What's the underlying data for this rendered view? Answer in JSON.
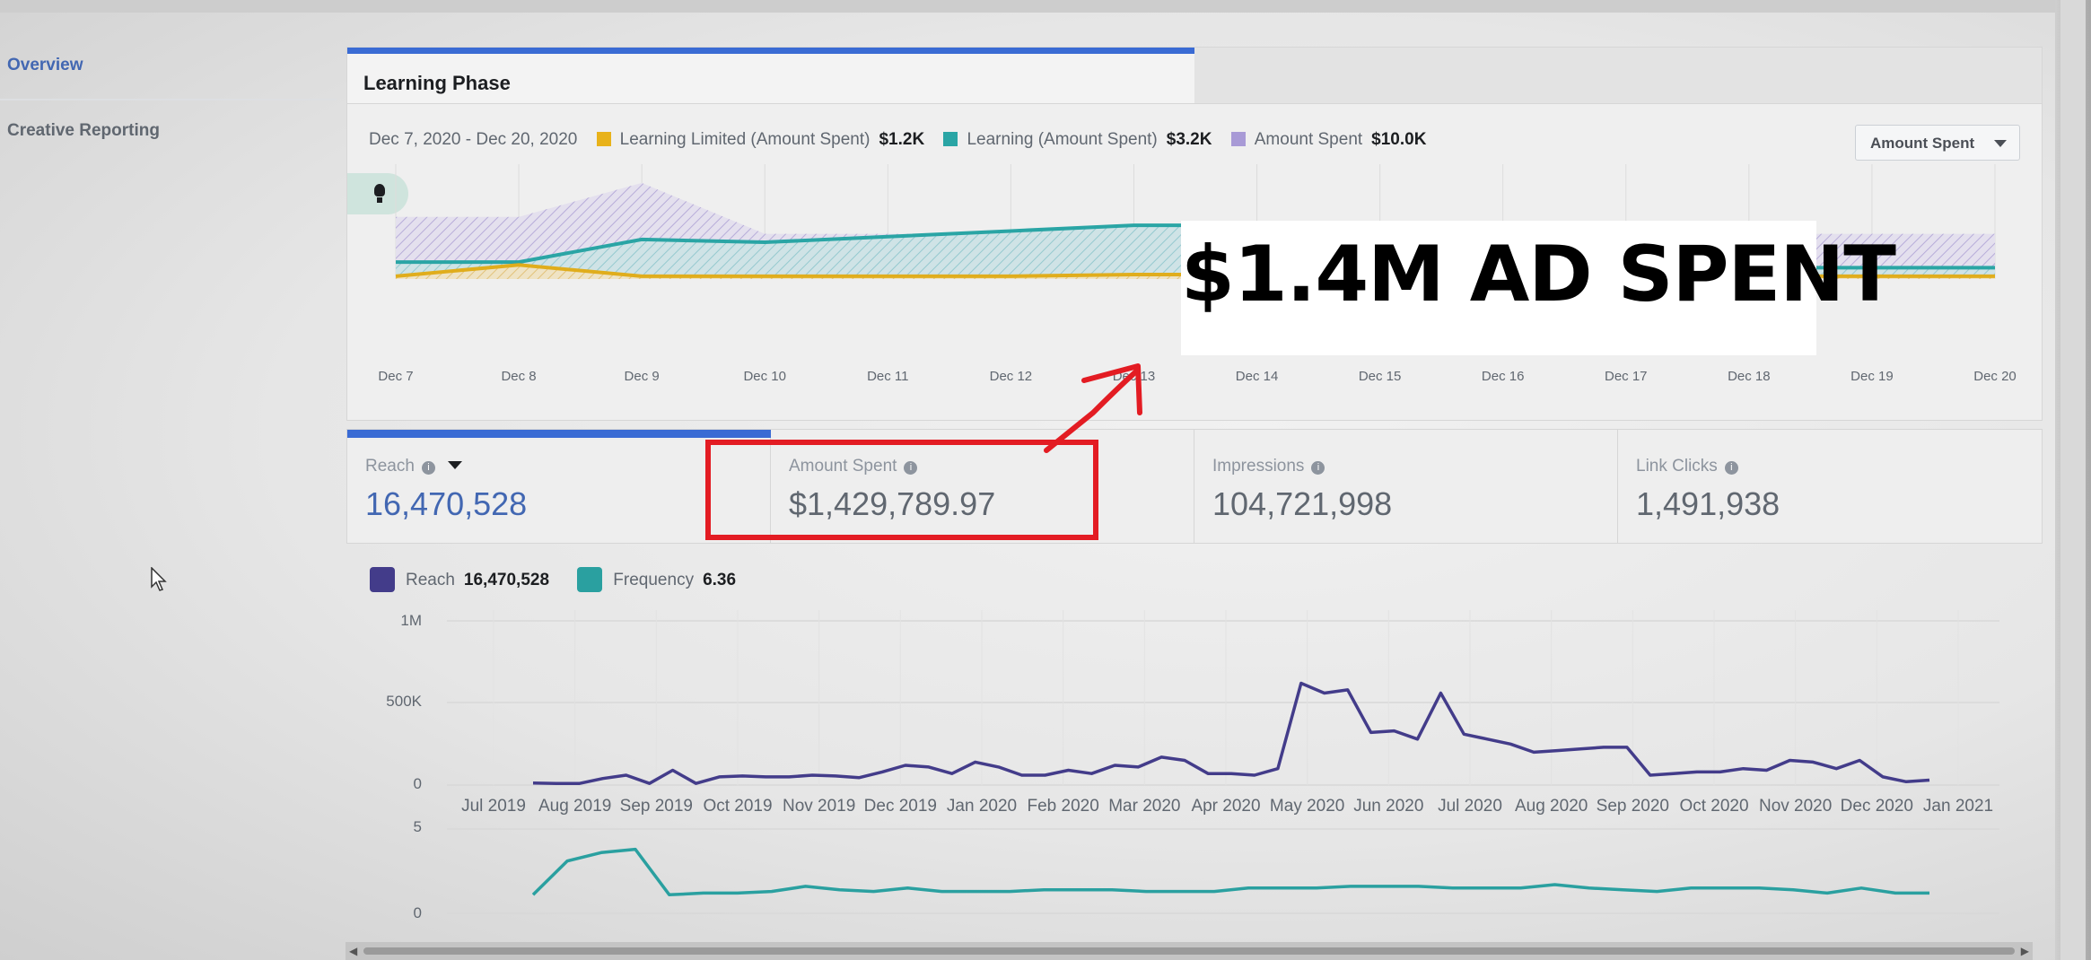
{
  "sidebar": {
    "items": [
      {
        "label": "Overview",
        "active": true
      },
      {
        "label": "Creative Reporting",
        "active": false
      }
    ]
  },
  "learning_phase": {
    "tab_label": "Learning Phase",
    "date_range": "Dec 7, 2020 - Dec 20, 2020",
    "legend": [
      {
        "label": "Learning Limited (Amount Spent)",
        "value": "$1.2K",
        "color": "#e8b21a"
      },
      {
        "label": "Learning (Amount Spent)",
        "value": "$3.2K",
        "color": "#2aa5a5"
      },
      {
        "label": "Amount Spent",
        "value": "$10.0K",
        "color": "#a89ad6"
      }
    ],
    "metric_dropdown": "Amount Spent",
    "x_labels": [
      "Dec 7",
      "Dec 8",
      "Dec 9",
      "Dec 10",
      "Dec 11",
      "Dec 12",
      "Dec 13",
      "Dec 14",
      "Dec 15",
      "Dec 16",
      "Dec 17",
      "Dec 18",
      "Dec 19",
      "Dec 20"
    ]
  },
  "kpis": [
    {
      "label": "Reach",
      "value": "16,470,528",
      "active": true
    },
    {
      "label": "Amount Spent",
      "value": "$1,429,789.97",
      "active": false
    },
    {
      "label": "Impressions",
      "value": "104,721,998",
      "active": false
    },
    {
      "label": "Link Clicks",
      "value": "1,491,938",
      "active": false
    }
  ],
  "reach_chart": {
    "legend": [
      {
        "label": "Reach",
        "value": "16,470,528",
        "color": "#433c8a"
      },
      {
        "label": "Frequency",
        "value": "6.36",
        "color": "#2aa0a0"
      }
    ],
    "reach_y_ticks": [
      "1M",
      "500K",
      "0"
    ],
    "freq_y_ticks": [
      "5",
      "0"
    ],
    "months": [
      "Jul 2019",
      "Aug 2019",
      "Sep 2019",
      "Oct 2019",
      "Nov 2019",
      "Dec 2019",
      "Jan 2020",
      "Feb 2020",
      "Mar 2020",
      "Apr 2020",
      "May 2020",
      "Jun 2020",
      "Jul 2020",
      "Aug 2020",
      "Sep 2020",
      "Oct 2020",
      "Nov 2020",
      "Dec 2020",
      "Jan 2021"
    ]
  },
  "overlay": {
    "callout_text": "$1.4M AD SPENT",
    "arrow_color": "#e31c23"
  },
  "chart_data": [
    {
      "type": "area",
      "categories": [
        "Dec 7",
        "Dec 8",
        "Dec 9",
        "Dec 10",
        "Dec 11",
        "Dec 12",
        "Dec 13",
        "Dec 14",
        "Dec 15",
        "Dec 16",
        "Dec 17",
        "Dec 18",
        "Dec 19",
        "Dec 20"
      ],
      "series": [
        {
          "name": "Amount Spent",
          "values": [
            1.1,
            1.1,
            1.7,
            0.8,
            0.8,
            0.8,
            0.8,
            0.8,
            0.8,
            0.8,
            0.8,
            0.8,
            0.8,
            0.8
          ]
        },
        {
          "name": "Learning (Amount Spent)",
          "values": [
            0.3,
            0.3,
            0.7,
            0.65,
            0.75,
            0.85,
            0.95,
            0.95,
            0.2,
            0.2,
            0.2,
            0.2,
            0.2,
            0.2
          ]
        },
        {
          "name": "Learning Limited (Amount Spent)",
          "values": [
            0.05,
            0.25,
            0.05,
            0.05,
            0.05,
            0.05,
            0.08,
            0.08,
            0.05,
            0.05,
            0.05,
            0.05,
            0.05,
            0.05
          ]
        }
      ],
      "grid": true
    },
    {
      "type": "line",
      "y_ticks": [
        "1M",
        "500K",
        "0"
      ],
      "ylim": [
        0,
        1000000
      ],
      "series": [
        {
          "name": "Reach",
          "values": [
            12000,
            10000,
            10000,
            40000,
            60000,
            10000,
            90000,
            10000,
            50000,
            55000,
            50000,
            50000,
            60000,
            55000,
            45000,
            80000,
            120000,
            110000,
            70000,
            140000,
            110000,
            60000,
            60000,
            90000,
            70000,
            120000,
            110000,
            170000,
            150000,
            70000,
            70000,
            60000,
            100000,
            620000,
            560000,
            580000,
            320000,
            330000,
            280000,
            560000,
            310000,
            280000,
            250000,
            200000,
            210000,
            220000,
            230000,
            230000,
            60000,
            70000,
            80000,
            80000,
            100000,
            90000,
            150000,
            140000,
            100000,
            150000,
            50000,
            20000,
            30000
          ]
        }
      ],
      "months": [
        "Jul 2019",
        "Aug 2019",
        "Sep 2019",
        "Oct 2019",
        "Nov 2019",
        "Dec 2019",
        "Jan 2020",
        "Feb 2020",
        "Mar 2020",
        "Apr 2020",
        "May 2020",
        "Jun 2020",
        "Jul 2020",
        "Aug 2020",
        "Sep 2020",
        "Oct 2020",
        "Nov 2020",
        "Dec 2020",
        "Jan 2021"
      ],
      "grid": true
    },
    {
      "type": "line",
      "y_ticks": [
        "5",
        "0"
      ],
      "ylim": [
        0,
        5
      ],
      "series": [
        {
          "name": "Frequency",
          "values": [
            1.1,
            3.1,
            3.6,
            3.8,
            1.1,
            1.2,
            1.2,
            1.3,
            1.6,
            1.4,
            1.3,
            1.5,
            1.3,
            1.3,
            1.3,
            1.4,
            1.4,
            1.4,
            1.3,
            1.3,
            1.3,
            1.5,
            1.5,
            1.5,
            1.6,
            1.6,
            1.6,
            1.5,
            1.5,
            1.5,
            1.7,
            1.5,
            1.4,
            1.3,
            1.5,
            1.5,
            1.5,
            1.4,
            1.2,
            1.5,
            1.2,
            1.2
          ]
        }
      ]
    }
  ]
}
